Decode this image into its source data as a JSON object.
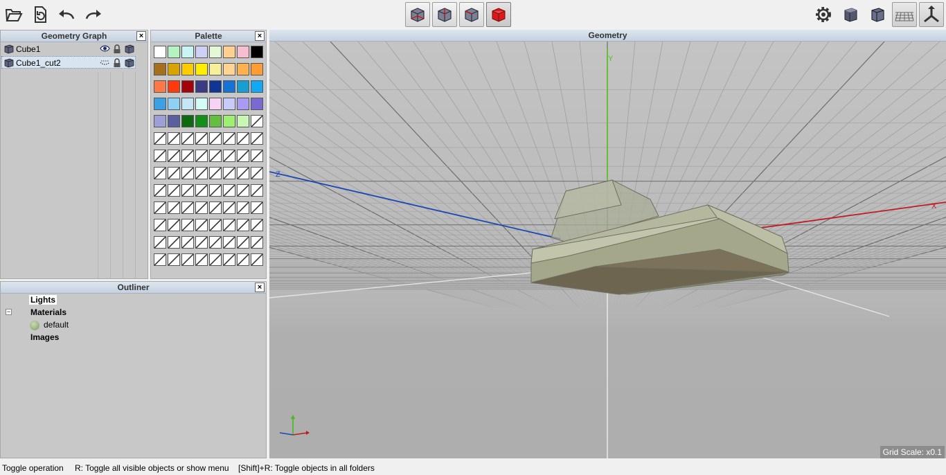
{
  "toolbar": {
    "left_icons": [
      "open-folder-icon",
      "refresh-document-icon",
      "undo-icon",
      "redo-icon"
    ],
    "view_icons": [
      "wireframe-cube-icon",
      "hidden-line-cube-icon",
      "edges-cube-icon",
      "solid-red-cube-icon"
    ],
    "right_icons": [
      "settings-gear-icon",
      "shaded-cube-icon",
      "outlined-cube-icon",
      "grid-plane-icon",
      "axes-icon"
    ]
  },
  "geometry_graph": {
    "title": "Geometry Graph",
    "close": "×",
    "items": [
      {
        "label": "Cube1"
      },
      {
        "label": "Cube1_cut2"
      }
    ]
  },
  "palette": {
    "title": "Palette",
    "close": "×",
    "colors": [
      "#ffffff",
      "#b6f3c3",
      "#c8f4f4",
      "#cfd0f8",
      "#e4f7d7",
      "#ffd090",
      "#f6bfcf",
      "#000000",
      "#a5701c",
      "#d9a400",
      "#ffcc00",
      "#ffee00",
      "#f7ef9a",
      "#ffd591",
      "#ffb14d",
      "#ff9d35",
      "#ff7847",
      "#ff3b0e",
      "#a3030b",
      "#3b3b83",
      "#0f3595",
      "#1673d6",
      "#179fd1",
      "#14a7f2",
      "#3aa1e5",
      "#8fd0f5",
      "#c5e6f7",
      "#d3fcf9",
      "#f8d2f4",
      "#c9c9fa",
      "#a99af4",
      "#7b69d1",
      "#9f9fd8",
      "#5a5f9f",
      "#0d6a11",
      "#138f1a",
      "#62c03e",
      "#9df070",
      "#c8f7b4",
      "empty"
    ],
    "rows_total": 13
  },
  "outliner": {
    "title": "Outliner",
    "close": "×",
    "collapse_glyph": "−",
    "lights": "Lights",
    "materials": "Materials",
    "material_default": "default",
    "images": "Images"
  },
  "viewport": {
    "title": "Geometry",
    "axis_y": "Y",
    "axis_z": "Z",
    "axis_x": "X",
    "grid_scale": "Grid Scale: x0.1"
  },
  "statusbar": {
    "item1": "Toggle operation",
    "item2": "R: Toggle all visible objects or show menu",
    "item3": "[Shift]+R: Toggle objects in all folders"
  }
}
